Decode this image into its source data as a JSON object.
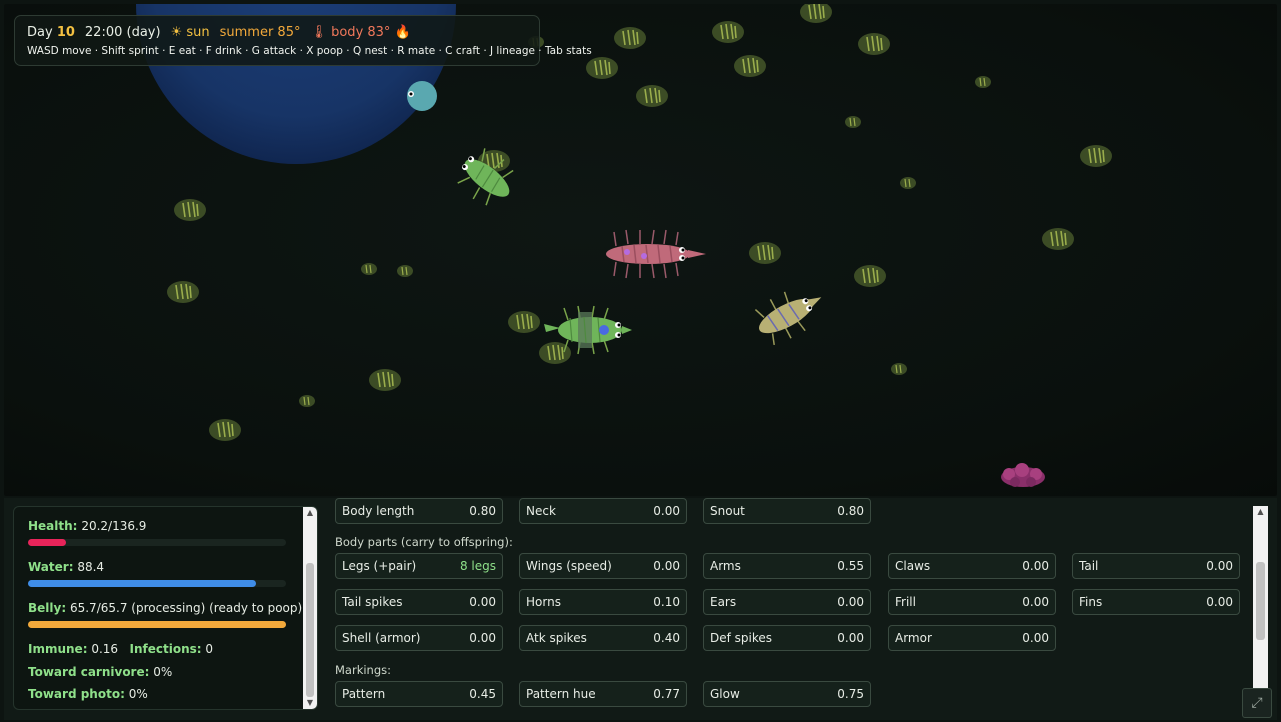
{
  "hud": {
    "day_label": "Day",
    "day_number": "10",
    "time": "22:00 (day)",
    "weather": "☀ sun",
    "season": "summer 85°",
    "body_temp": "🌡 body 83° 🔥",
    "controls": "WASD move · Shift sprint · E eat · F drink · G attack · X poop · Q nest · R mate · C craft · J lineage · Tab stats"
  },
  "stats": {
    "health_label": "Health:",
    "health_value": "20.2/136.9",
    "health_level": 0.147,
    "health_color": "#e8245a",
    "water_label": "Water:",
    "water_value": "88.4",
    "water_level": 0.884,
    "water_color": "#3f8de8",
    "belly_label": "Belly:",
    "belly_value": "65.7/65.7 (processing) (ready to poop)",
    "belly_level": 1.0,
    "belly_color": "#f2a93b",
    "immune_label": "Immune:",
    "immune_value": "0.16",
    "infections_label": "Infections:",
    "infections_value": "0",
    "carnivore_label": "Toward carnivore:",
    "carnivore_value": "0%",
    "photo_label": "Toward photo:",
    "photo_value": "0%"
  },
  "traits": {
    "top_row": [
      {
        "label": "Body length",
        "value": "0.80"
      },
      {
        "label": "Neck",
        "value": "0.00"
      },
      {
        "label": "Snout",
        "value": "0.80"
      }
    ],
    "body_parts_heading": "Body parts (carry to offspring):",
    "body_parts": [
      {
        "label": "Legs (+pair)",
        "value": "8 legs"
      },
      {
        "label": "Wings (speed)",
        "value": "0.00"
      },
      {
        "label": "Arms",
        "value": "0.55"
      },
      {
        "label": "Claws",
        "value": "0.00"
      },
      {
        "label": "Tail",
        "value": "0.00"
      },
      {
        "label": "Tail spikes",
        "value": "0.00"
      },
      {
        "label": "Horns",
        "value": "0.10"
      },
      {
        "label": "Ears",
        "value": "0.00"
      },
      {
        "label": "Frill",
        "value": "0.00"
      },
      {
        "label": "Fins",
        "value": "0.00"
      },
      {
        "label": "Shell (armor)",
        "value": "0.00"
      },
      {
        "label": "Atk spikes",
        "value": "0.40"
      },
      {
        "label": "Def spikes",
        "value": "0.00"
      },
      {
        "label": "Armor",
        "value": "0.00"
      }
    ],
    "markings_heading": "Markings:",
    "markings": [
      {
        "label": "Pattern",
        "value": "0.45"
      },
      {
        "label": "Pattern hue",
        "value": "0.77"
      },
      {
        "label": "Glow",
        "value": "0.75"
      }
    ]
  },
  "icons": {
    "sun": "sun-icon",
    "thermometer": "thermometer-icon",
    "flame": "flame-icon",
    "fullscreen": "fullscreen-icon"
  }
}
